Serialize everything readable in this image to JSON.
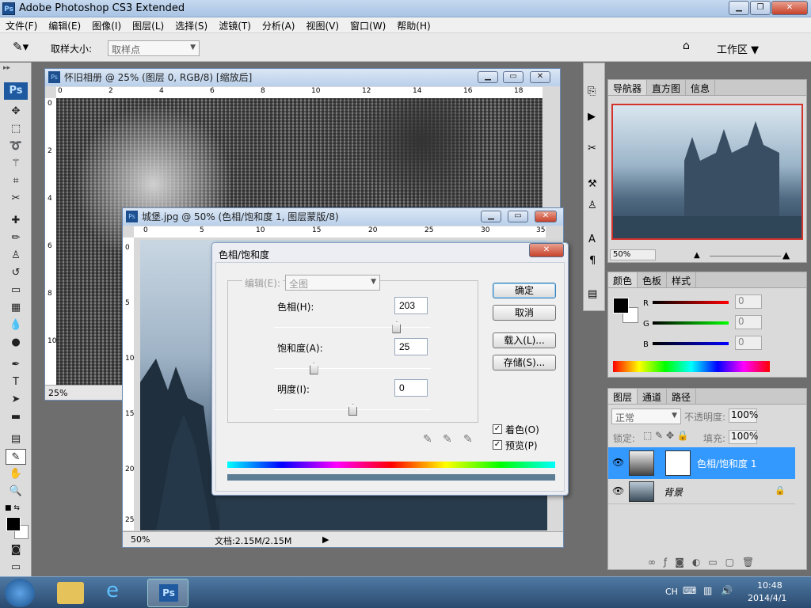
{
  "app": {
    "title": "Adobe Photoshop CS3 Extended",
    "icon_label": "Ps"
  },
  "menu": [
    "文件(F)",
    "编辑(E)",
    "图像(I)",
    "图层(L)",
    "选择(S)",
    "滤镜(T)",
    "分析(A)",
    "视图(V)",
    "窗口(W)",
    "帮助(H)"
  ],
  "options": {
    "sample_size_label": "取样大小:",
    "sample_size_value": "取样点",
    "workspace_label": "工作区"
  },
  "doc1": {
    "title": "怀旧相册 @ 25% (图层 0, RGB/8) [缩放后]",
    "zoom": "25%",
    "ruler_h": [
      "0",
      "2",
      "4",
      "6",
      "8",
      "10",
      "12",
      "14",
      "16",
      "18"
    ],
    "ruler_v": [
      "0",
      "2",
      "4",
      "6",
      "8",
      "10"
    ]
  },
  "doc2": {
    "title": "城堡.jpg @ 50% (色相/饱和度 1, 图层蒙版/8)",
    "zoom": "50%",
    "doc_info": "文档:2.15M/2.15M",
    "ruler_h": [
      "0",
      "5",
      "10",
      "15",
      "20",
      "25",
      "30",
      "35"
    ],
    "ruler_v": [
      "0",
      "5",
      "10",
      "15",
      "20",
      "25"
    ]
  },
  "dialog": {
    "title": "色相/饱和度",
    "edit_label": "编辑(E):",
    "edit_value": "全图",
    "hue_label": "色相(H):",
    "hue_value": "203",
    "sat_label": "饱和度(A):",
    "sat_value": "25",
    "light_label": "明度(I):",
    "light_value": "0",
    "hue_slider": 0.78,
    "sat_slider": 0.25,
    "light_slider": 0.5,
    "ok": "确定",
    "cancel": "取消",
    "load": "载入(L)...",
    "save": "存储(S)...",
    "colorize": "着色(O)",
    "preview": "预览(P)",
    "colorize_checked": "✓",
    "preview_checked": "✓"
  },
  "navigator": {
    "tabs": [
      "导航器",
      "直方图",
      "信息"
    ],
    "zoom": "50%"
  },
  "color": {
    "tabs": [
      "颜色",
      "色板",
      "样式"
    ],
    "r_label": "R",
    "g_label": "G",
    "b_label": "B",
    "r": "0",
    "g": "0",
    "b": "0"
  },
  "layers": {
    "tabs": [
      "图层",
      "通道",
      "路径"
    ],
    "blend_mode": "正常",
    "opacity_label": "不透明度:",
    "opacity": "100%",
    "lock_label": "锁定:",
    "fill_label": "填充:",
    "fill": "100%",
    "items": [
      {
        "name": "色相/饱和度 1"
      },
      {
        "name": "背景"
      }
    ]
  },
  "taskbar": {
    "lang": "CH",
    "time": "10:48",
    "date": "2014/4/1",
    "ps_label": "Ps"
  },
  "colors": {
    "accent": "#3399ff",
    "title_bg": "#b9cfea"
  }
}
